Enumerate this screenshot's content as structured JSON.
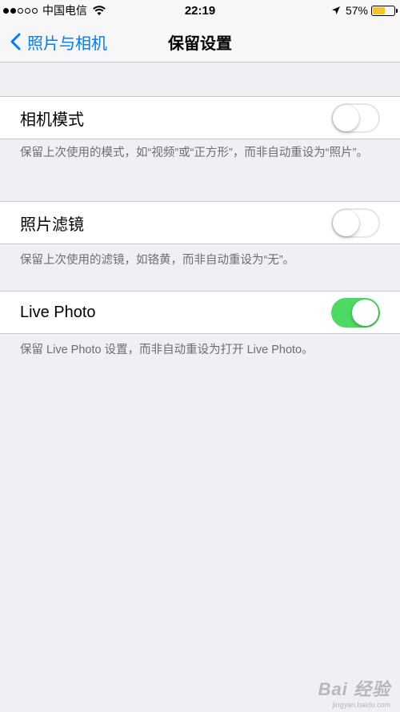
{
  "status_bar": {
    "carrier": "中国电信",
    "time": "22:19",
    "battery_percent": "57%",
    "battery_level": 0.57,
    "battery_color": "#f4c430",
    "signal_bars_filled": 2,
    "signal_bars_total": 5
  },
  "nav": {
    "back_label": "照片与相机",
    "title": "保留设置"
  },
  "settings": [
    {
      "label": "相机模式",
      "enabled": false,
      "footnote": "保留上次使用的模式，如“视频”或“正方形”，而非自动重设为“照片”。"
    },
    {
      "label": "照片滤镜",
      "enabled": false,
      "footnote": "保留上次使用的滤镜，如铬黄，而非自动重设为“无”。"
    },
    {
      "label": "Live Photo",
      "enabled": true,
      "footnote": "保留 Live Photo 设置，而非自动重设为打开 Live Photo。"
    }
  ],
  "colors": {
    "accent": "#007aff",
    "toggle_on": "#4cd964",
    "background": "#efeff4"
  },
  "watermark": {
    "logo": "Bai 经验",
    "url": "jingyan.baidu.com"
  }
}
